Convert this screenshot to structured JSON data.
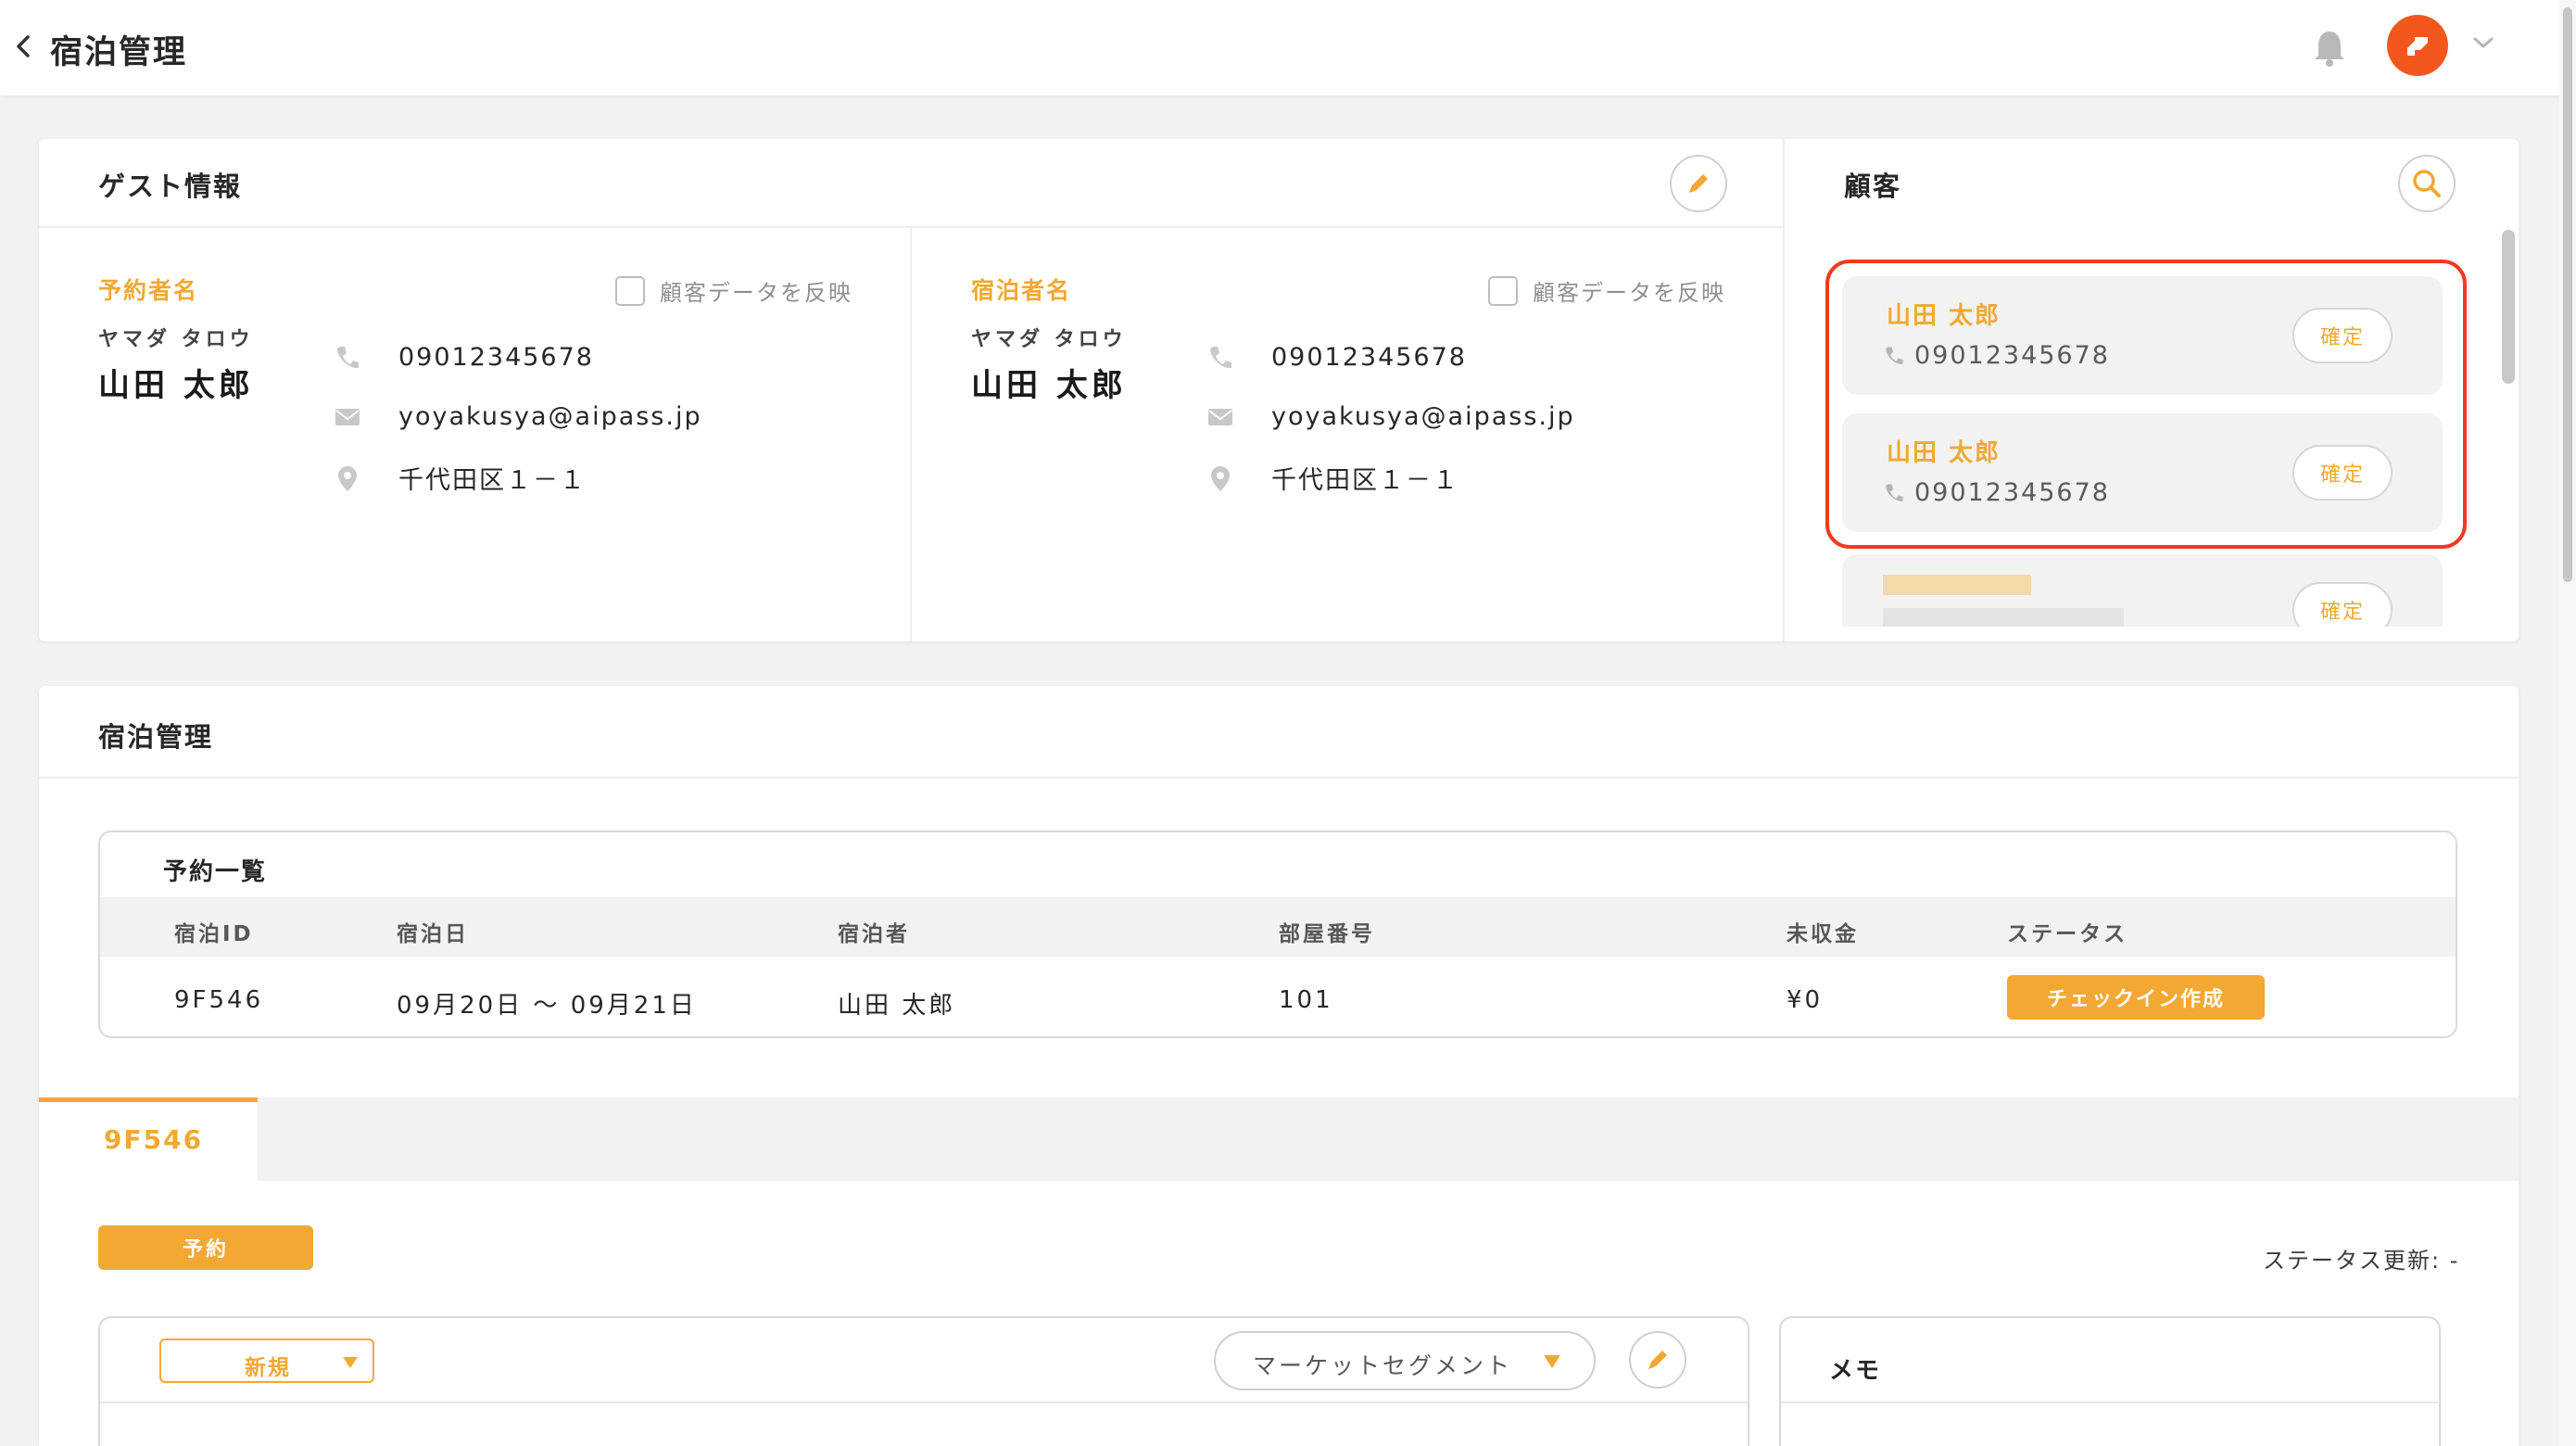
{
  "header": {
    "title": "宿泊管理"
  },
  "guest_info": {
    "title": "ゲスト情報",
    "reserver": {
      "label": "予約者名",
      "reflect_checkbox_label": "顧客データを反映",
      "kana": "ヤマダ タロウ",
      "name": "山田 太郎",
      "phone": "09012345678",
      "email": "yoyakusya@aipass.jp",
      "address": "千代田区１－１"
    },
    "guest": {
      "label": "宿泊者名",
      "reflect_checkbox_label": "顧客データを反映",
      "kana": "ヤマダ タロウ",
      "name": "山田 太郎",
      "phone": "09012345678",
      "email": "yoyakusya@aipass.jp",
      "address": "千代田区１－１"
    }
  },
  "customers": {
    "title": "顧客",
    "items": [
      {
        "name": "山田 太郎",
        "phone": "09012345678",
        "confirm_label": "確定"
      },
      {
        "name": "山田 太郎",
        "phone": "09012345678",
        "confirm_label": "確定"
      },
      {
        "confirm_label": "確定"
      }
    ]
  },
  "stay_management": {
    "title": "宿泊管理",
    "reservation_list": {
      "title": "予約一覧",
      "columns": [
        "宿泊ID",
        "宿泊日",
        "宿泊者",
        "部屋番号",
        "未収金",
        "ステータス"
      ],
      "rows": [
        {
          "id": "9F546",
          "dates": "09月20日 ～ 09月21日",
          "guest": "山田 太郎",
          "room": "101",
          "balance": "¥0",
          "status_action": "チェックイン作成"
        }
      ]
    },
    "tabs": [
      {
        "label": "9F546",
        "active": true
      }
    ],
    "reservation_badge": "予約",
    "status_update": "ステータス更新: -",
    "detail": {
      "type_select": "新規",
      "market_segment_select": "マーケットセグメント"
    },
    "memo_title": "メモ"
  },
  "colors": {
    "accent": "#f2a832",
    "highlight": "#f03a1f",
    "avatar": "#f2581d"
  }
}
